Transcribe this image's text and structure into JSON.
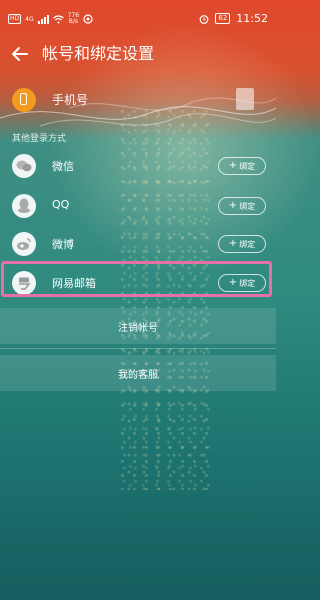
{
  "status_bar": {
    "speed": "776",
    "speed_unit": "B/s",
    "network": "4G",
    "battery": "62",
    "time": "11:52"
  },
  "header": {
    "title": "帐号和绑定设置"
  },
  "phone": {
    "label": "手机号"
  },
  "section": {
    "other_methods": "其他登录方式"
  },
  "bind_label": "绑定",
  "accounts": [
    {
      "label": "微信",
      "icon": "wechat-icon"
    },
    {
      "label": "QQ",
      "icon": "qq-icon"
    },
    {
      "label": "微博",
      "icon": "weibo-icon"
    },
    {
      "label": "网易邮箱",
      "icon": "netease-mail-icon"
    }
  ],
  "actions": {
    "cancel_account": "注销帐号",
    "customer_service": "我的客服"
  },
  "colors": {
    "accent_highlight": "#e870a8",
    "phone_icon": "#f39a1e"
  }
}
